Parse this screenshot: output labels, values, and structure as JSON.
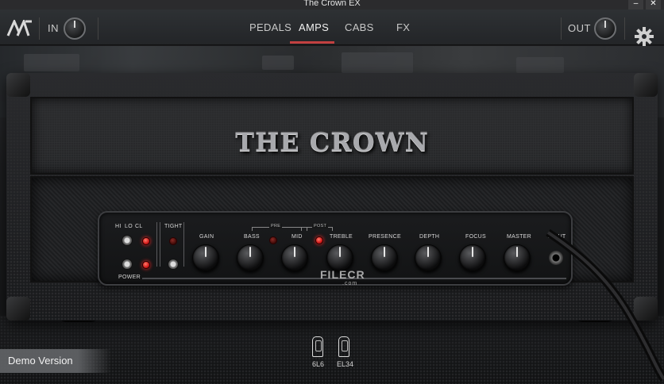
{
  "window": {
    "title": "The Crown EX",
    "minimize_symbol": "–",
    "close_symbol": "✕"
  },
  "header": {
    "in_label": "IN",
    "out_label": "OUT",
    "tabs": [
      {
        "label": "PEDALS",
        "active": false
      },
      {
        "label": "AMPS",
        "active": true
      },
      {
        "label": "CABS",
        "active": false
      },
      {
        "label": "FX",
        "active": false
      }
    ],
    "accent_color": "#c24040",
    "icons": {
      "logo": "brand-logo-icon",
      "settings": "gear-icon"
    }
  },
  "amp": {
    "name": "THE CROWN",
    "mode_labels": [
      "HI",
      "LO",
      "CL"
    ],
    "tight_label": "TIGHT",
    "power_label": "POWER",
    "knobs": [
      "GAIN",
      "BASS",
      "MID",
      "TREBLE",
      "PRESENCE",
      "DEPTH",
      "FOCUS",
      "MASTER"
    ],
    "pre_label": "PRE",
    "post_label": "POST",
    "input_label": "INPUT"
  },
  "tubes": [
    {
      "label": "6L6"
    },
    {
      "label": "EL34"
    }
  ],
  "watermark": {
    "text": "FILECR",
    "sub": ".com"
  },
  "demo_badge": "Demo Version"
}
